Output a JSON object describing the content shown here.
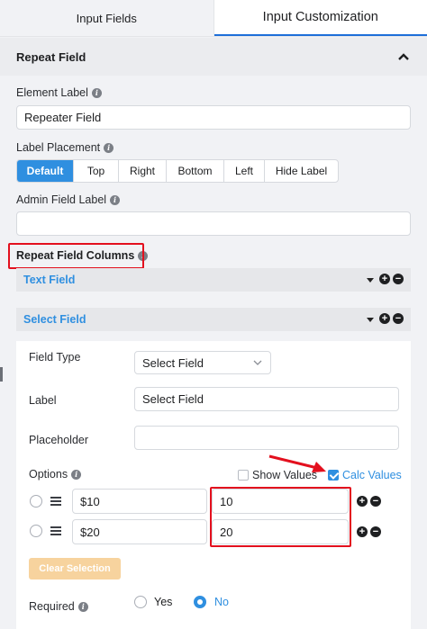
{
  "tabs": [
    {
      "label": "Input Fields",
      "active": false
    },
    {
      "label": "Input Customization",
      "active": true
    }
  ],
  "section": {
    "title": "Repeat Field"
  },
  "element_label": {
    "label": "Element Label",
    "value": "Repeater Field"
  },
  "label_placement": {
    "label": "Label Placement",
    "options": [
      "Default",
      "Top",
      "Right",
      "Bottom",
      "Left",
      "Hide Label"
    ],
    "selected": "Default"
  },
  "admin_field_label": {
    "label": "Admin Field Label",
    "value": ""
  },
  "repeat_columns": {
    "label": "Repeat Field Columns",
    "columns": [
      {
        "title": "Text Field"
      },
      {
        "title": "Select Field"
      }
    ]
  },
  "select_field_panel": {
    "field_type": {
      "label": "Field Type",
      "value": "Select Field"
    },
    "label_field": {
      "label": "Label",
      "value": "Select Field"
    },
    "placeholder": {
      "label": "Placeholder",
      "value": ""
    },
    "options": {
      "label": "Options",
      "show_values": {
        "label": "Show Values",
        "checked": false
      },
      "calc_values": {
        "label": "Calc Values",
        "checked": true
      },
      "rows": [
        {
          "label": "$10",
          "calc": "10"
        },
        {
          "label": "$20",
          "calc": "20"
        }
      ]
    },
    "clear_selection": "Clear Selection",
    "required": {
      "label": "Required",
      "yes": "Yes",
      "no": "No",
      "selected": "No"
    }
  },
  "colors": {
    "accent": "#2f8fe0",
    "highlight": "#e3101e",
    "clear_button": "#f7d39e"
  },
  "icons": [
    "info-icon",
    "chevron-up-icon",
    "chevron-down-icon",
    "plus-circle-icon",
    "minus-circle-icon",
    "drag-handle-icon",
    "arrow-annotation"
  ]
}
